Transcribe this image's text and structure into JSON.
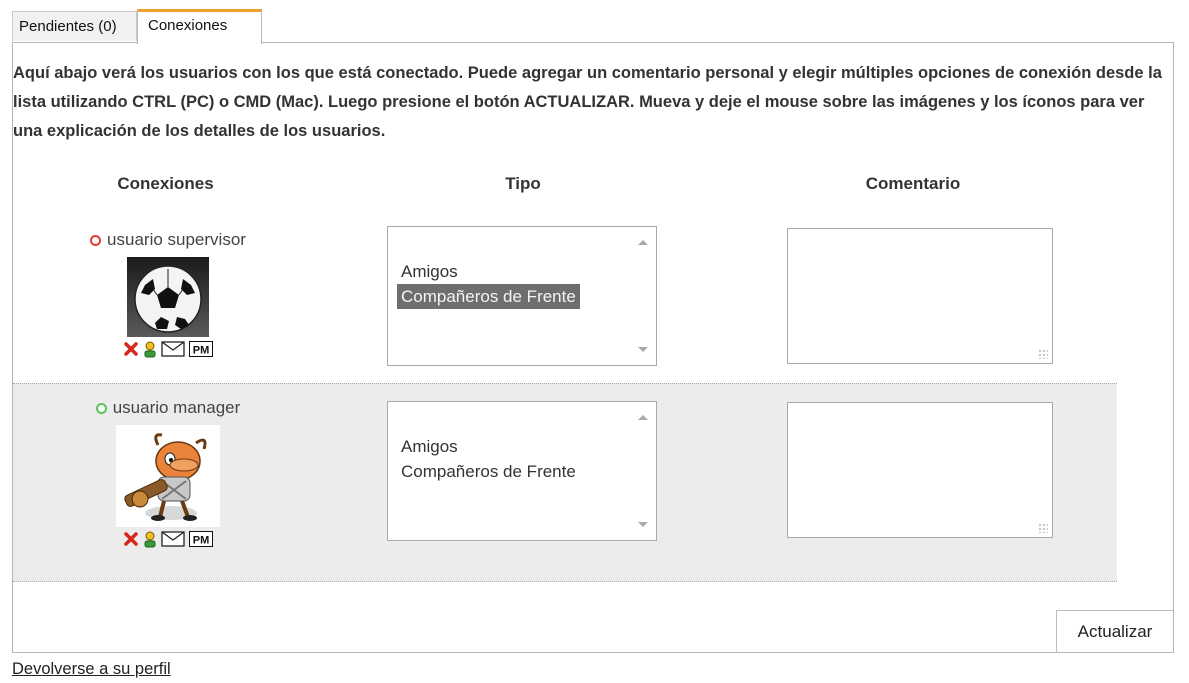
{
  "tabs": [
    {
      "label": "Pendientes (0)",
      "active": false
    },
    {
      "label": "Conexiones",
      "active": true
    }
  ],
  "intro": "Aquí abajo verá los usuarios con los que está conectado. Puede agregar un comentario personal y elegir múltiples opciones de conexión desde la lista utilizando CTRL (PC) o CMD (Mac). Luego presione el botón ACTUALIZAR. Mueva y deje el mouse sobre las imágenes y los íconos para ver una explicación de los detalles de los usuarios.",
  "headers": {
    "conexiones": "Conexiones",
    "tipo": "Tipo",
    "comentario": "Comentario"
  },
  "connections": [
    {
      "name": "usuario supervisor",
      "status": "offline",
      "status_color": "#e53a3a",
      "avatar": "soccer-ball",
      "actions": [
        "delete-icon",
        "profile-icon",
        "mail-icon",
        "pm-icon"
      ],
      "pm_label": "PM",
      "types": [
        {
          "label": "Amigos",
          "selected": false
        },
        {
          "label": "Compañeros de Frente",
          "selected": true
        }
      ],
      "comment": ""
    },
    {
      "name": "usuario manager",
      "status": "online",
      "status_color": "#5cc25c",
      "avatar": "cartoon-character",
      "actions": [
        "delete-icon",
        "profile-icon",
        "mail-icon",
        "pm-icon"
      ],
      "pm_label": "PM",
      "types": [
        {
          "label": "Amigos",
          "selected": false
        },
        {
          "label": "Compañeros de Frente",
          "selected": false
        }
      ],
      "comment": ""
    }
  ],
  "update_button": "Actualizar",
  "back_link": "Devolverse a su perfil"
}
